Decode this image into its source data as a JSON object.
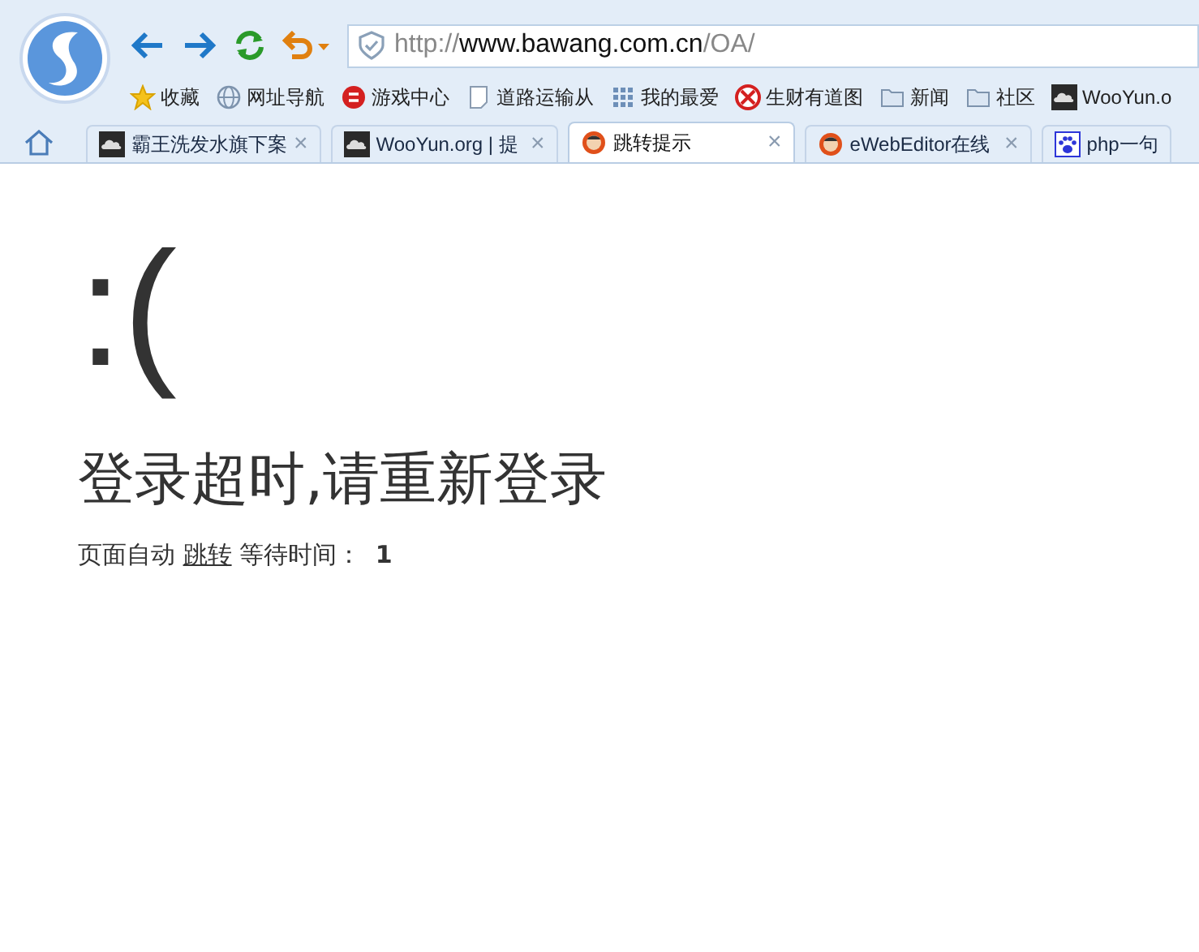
{
  "toolbar": {
    "address": {
      "scheme": "http://",
      "host": "www.bawang.com.cn",
      "path": "/OA/"
    }
  },
  "bookmarks": [
    {
      "label": "收藏",
      "kind": "star"
    },
    {
      "label": "网址导航",
      "kind": "globe"
    },
    {
      "label": "游戏中心",
      "kind": "game"
    },
    {
      "label": "道路运输从",
      "kind": "page"
    },
    {
      "label": "我的最爱",
      "kind": "grid"
    },
    {
      "label": "生财有道图",
      "kind": "badge"
    },
    {
      "label": "新闻",
      "kind": "folder"
    },
    {
      "label": "社区",
      "kind": "folder"
    },
    {
      "label": "WooYun.o",
      "kind": "cloud"
    }
  ],
  "tabs": [
    {
      "title": "霸王洗发水旗下案",
      "kind": "cloud",
      "selected": false,
      "close": "×"
    },
    {
      "title": "WooYun.org | 提",
      "kind": "cloud",
      "selected": false,
      "close": "×"
    },
    {
      "title": "跳转提示",
      "kind": "avatar",
      "selected": true,
      "close": "×"
    },
    {
      "title": "eWebEditor在线",
      "kind": "avatar",
      "selected": false,
      "close": "×"
    },
    {
      "title": "php一句",
      "kind": "paw",
      "selected": false
    }
  ],
  "page": {
    "emoticon": ":(",
    "heading": "登录超时,请重新登录",
    "notice": {
      "prefix": "页面自动",
      "link": "跳转",
      "suffix": "等待时间：",
      "countdown": "1"
    }
  }
}
